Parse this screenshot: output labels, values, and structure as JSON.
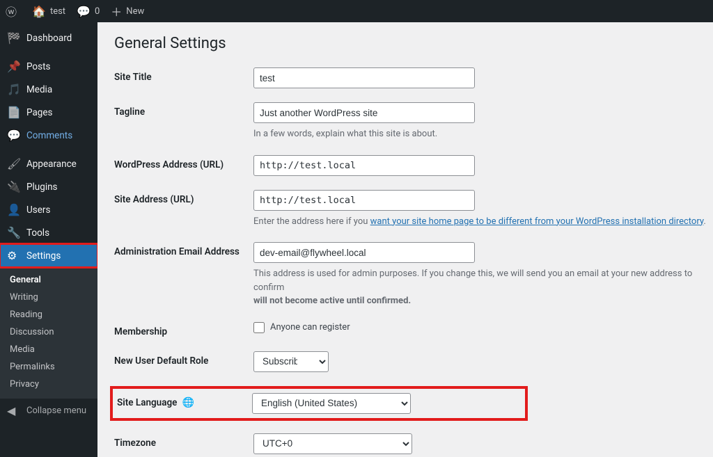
{
  "toolbar": {
    "site_name": "test",
    "comments_count": "0",
    "new_label": "New"
  },
  "sidebar": {
    "dashboard": "Dashboard",
    "posts": "Posts",
    "media": "Media",
    "pages": "Pages",
    "comments": "Comments",
    "appearance": "Appearance",
    "plugins": "Plugins",
    "users": "Users",
    "tools": "Tools",
    "settings": "Settings",
    "collapse": "Collapse menu",
    "sub": {
      "general": "General",
      "writing": "Writing",
      "reading": "Reading",
      "discussion": "Discussion",
      "media": "Media",
      "permalinks": "Permalinks",
      "privacy": "Privacy"
    }
  },
  "page": {
    "title": "General Settings",
    "site_title_label": "Site Title",
    "site_title_value": "test",
    "tagline_label": "Tagline",
    "tagline_value": "Just another WordPress site",
    "tagline_desc": "In a few words, explain what this site is about.",
    "wp_url_label": "WordPress Address (URL)",
    "wp_url_value": "http://test.local",
    "site_url_label": "Site Address (URL)",
    "site_url_value": "http://test.local",
    "site_url_desc_pre": "Enter the address here if you ",
    "site_url_desc_link": "want your site home page to be different from your WordPress installation directory",
    "site_url_desc_post": ".",
    "admin_email_label": "Administration Email Address",
    "admin_email_value": "dev-email@flywheel.local",
    "admin_email_desc_pre": "This address is used for admin purposes. If you change this, we will send you an email at your new address to confirm ",
    "admin_email_desc_strong": "will not become active until confirmed.",
    "membership_label": "Membership",
    "membership_chk": "Anyone can register",
    "role_label": "New User Default Role",
    "role_value": "Subscriber",
    "lang_label": "Site Language",
    "lang_value": "English (United States)",
    "tz_label": "Timezone",
    "tz_value": "UTC+0"
  }
}
